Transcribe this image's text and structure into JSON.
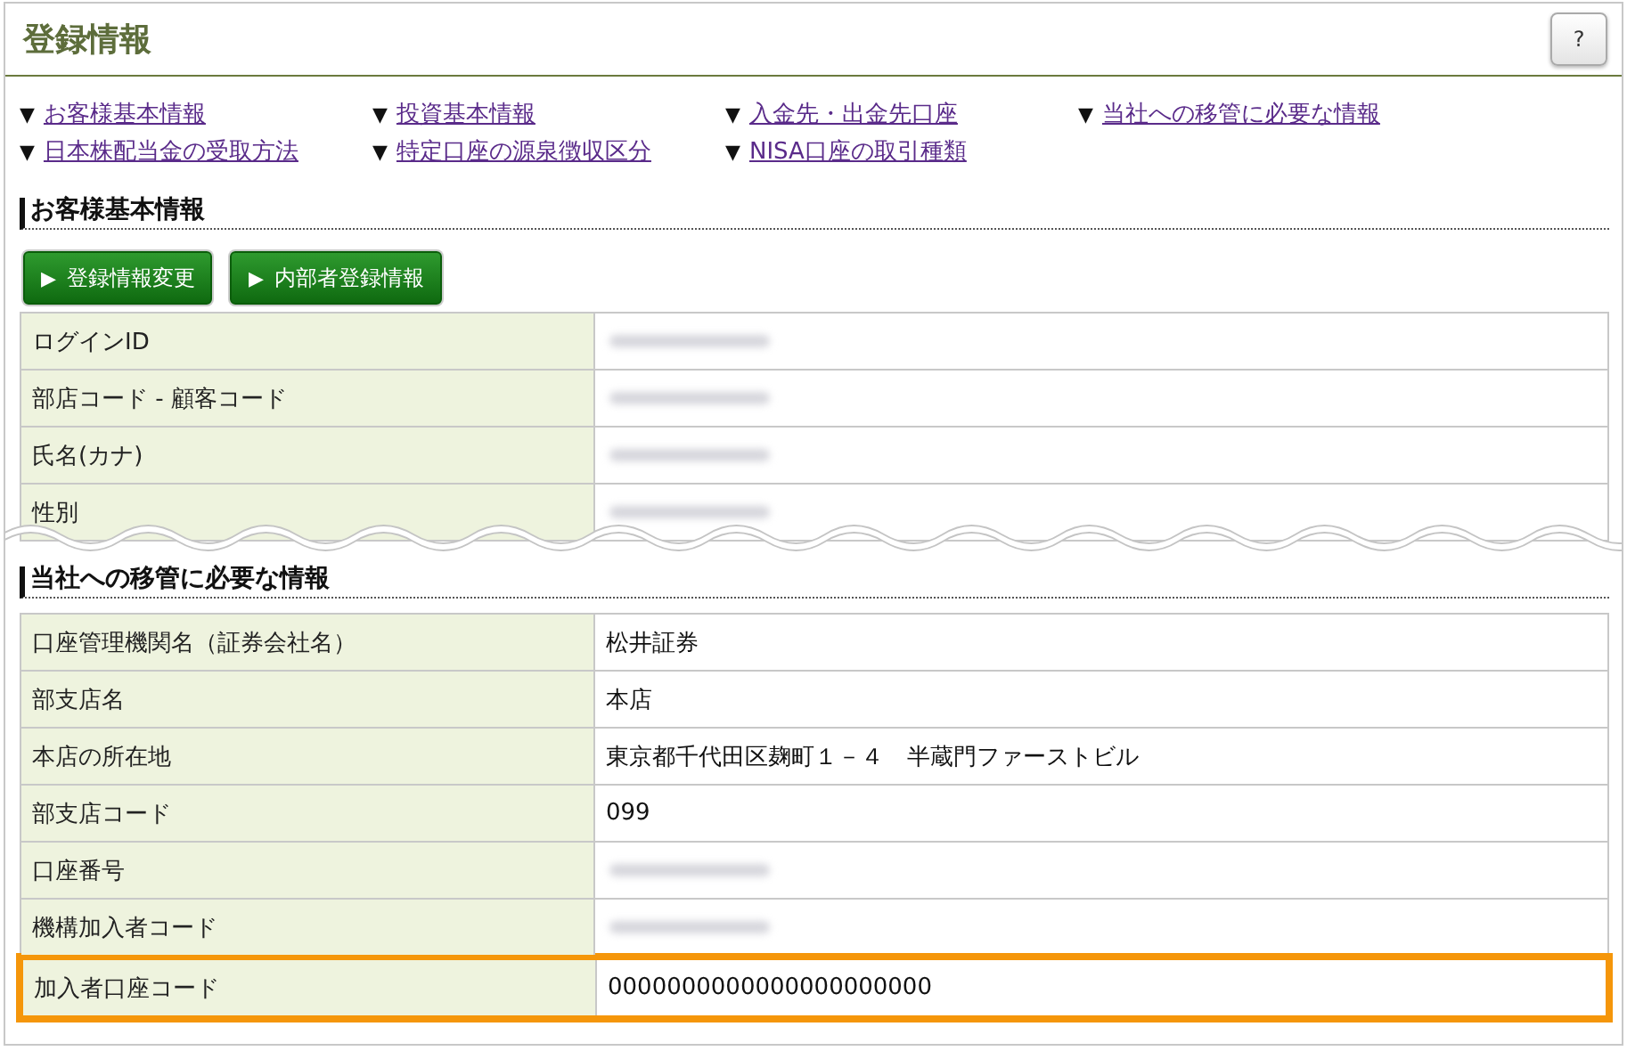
{
  "page_title": "登録情報",
  "help_button": "?",
  "nav_links": [
    {
      "marker": "▼",
      "label": "お客様基本情報"
    },
    {
      "marker": "▼",
      "label": "投資基本情報"
    },
    {
      "marker": "▼",
      "label": "入金先・出金先口座"
    },
    {
      "marker": "▼",
      "label": "当社への移管に必要な情報"
    },
    {
      "marker": "▼",
      "label": "日本株配当金の受取方法"
    },
    {
      "marker": "▼",
      "label": "特定口座の源泉徴収区分"
    },
    {
      "marker": "▼",
      "label": "NISA口座の取引種類"
    }
  ],
  "sections": [
    {
      "heading": "お客様基本情報",
      "buttons": [
        {
          "arrow": "▶",
          "label": "登録情報変更"
        },
        {
          "arrow": "▶",
          "label": "内部者登録情報"
        }
      ],
      "cut_off": true,
      "rows": [
        {
          "label": "ログインID",
          "redacted": true,
          "highlighted": false
        },
        {
          "label": "部店コード - 顧客コード",
          "redacted": true,
          "highlighted": false
        },
        {
          "label": "氏名(カナ)",
          "redacted": true,
          "highlighted": false
        },
        {
          "label": "性別",
          "redacted": true,
          "highlighted": false
        }
      ]
    },
    {
      "heading": "当社への移管に必要な情報",
      "cut_off": false,
      "rows": [
        {
          "label": "口座管理機関名（証券会社名）",
          "value": "松井証券",
          "redacted": false,
          "highlighted": false
        },
        {
          "label": "部支店名",
          "value": "本店",
          "redacted": false,
          "highlighted": false
        },
        {
          "label": "本店の所在地",
          "value": "東京都千代田区麹町１－４　半蔵門ファーストビル",
          "redacted": false,
          "highlighted": false
        },
        {
          "label": "部支店コード",
          "value": "099",
          "redacted": false,
          "highlighted": false
        },
        {
          "label": "口座番号",
          "redacted": true,
          "highlighted": false
        },
        {
          "label": "機構加入者コード",
          "redacted": true,
          "highlighted": false
        },
        {
          "label": "加入者口座コード",
          "value": "0000000000000000000000",
          "redacted": false,
          "highlighted": true
        }
      ]
    }
  ]
}
